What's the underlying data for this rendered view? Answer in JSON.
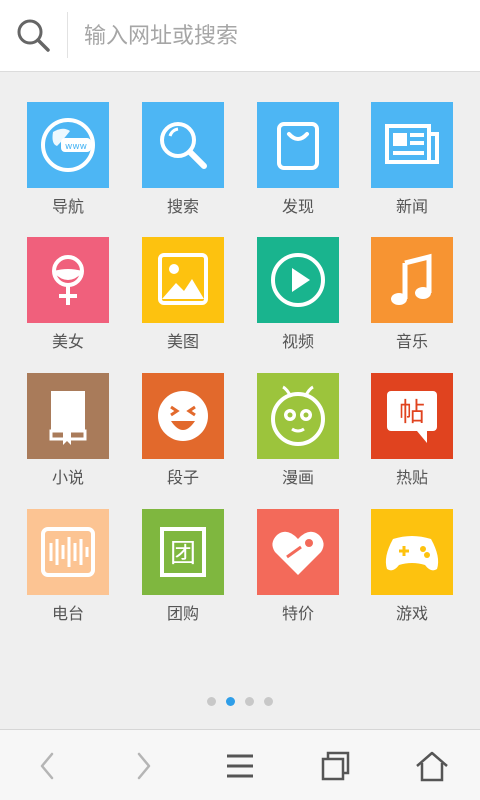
{
  "search": {
    "placeholder": "输入网址或搜索",
    "icon": "search-icon"
  },
  "tiles": [
    {
      "label": "导航",
      "icon": "navigation-icon",
      "color": "#4db6f4"
    },
    {
      "label": "搜索",
      "icon": "search-magnifier-icon",
      "color": "#4db6f4"
    },
    {
      "label": "发现",
      "icon": "shopping-bag-icon",
      "color": "#4db6f4"
    },
    {
      "label": "新闻",
      "icon": "newspaper-icon",
      "color": "#4db6f4"
    },
    {
      "label": "美女",
      "icon": "female-icon",
      "color": "#f0607c"
    },
    {
      "label": "美图",
      "icon": "picture-icon",
      "color": "#fdc20f"
    },
    {
      "label": "视频",
      "icon": "play-video-icon",
      "color": "#19b48e"
    },
    {
      "label": "音乐",
      "icon": "music-note-icon",
      "color": "#f79432"
    },
    {
      "label": "小说",
      "icon": "book-icon",
      "color": "#a97b5a"
    },
    {
      "label": "段子",
      "icon": "laughing-face-icon",
      "color": "#e2692c"
    },
    {
      "label": "漫画",
      "icon": "cartoon-ant-icon",
      "color": "#9cc43c"
    },
    {
      "label": "热贴",
      "icon": "post-bubble-icon",
      "color": "#e0431f"
    },
    {
      "label": "电台",
      "icon": "radio-icon",
      "color": "#fcc493"
    },
    {
      "label": "团购",
      "icon": "group-buy-icon",
      "color": "#7fb73f"
    },
    {
      "label": "特价",
      "icon": "price-tag-heart-icon",
      "color": "#f36a5a"
    },
    {
      "label": "游戏",
      "icon": "gamepad-icon",
      "color": "#fdc20f"
    }
  ],
  "tile_glyphs": {
    "post": "帖",
    "group": "团"
  },
  "pager": {
    "pages": 4,
    "current": 2
  },
  "bottom_nav": [
    {
      "name": "back-icon"
    },
    {
      "name": "forward-icon"
    },
    {
      "name": "menu-icon"
    },
    {
      "name": "windows-icon"
    },
    {
      "name": "home-icon"
    }
  ]
}
